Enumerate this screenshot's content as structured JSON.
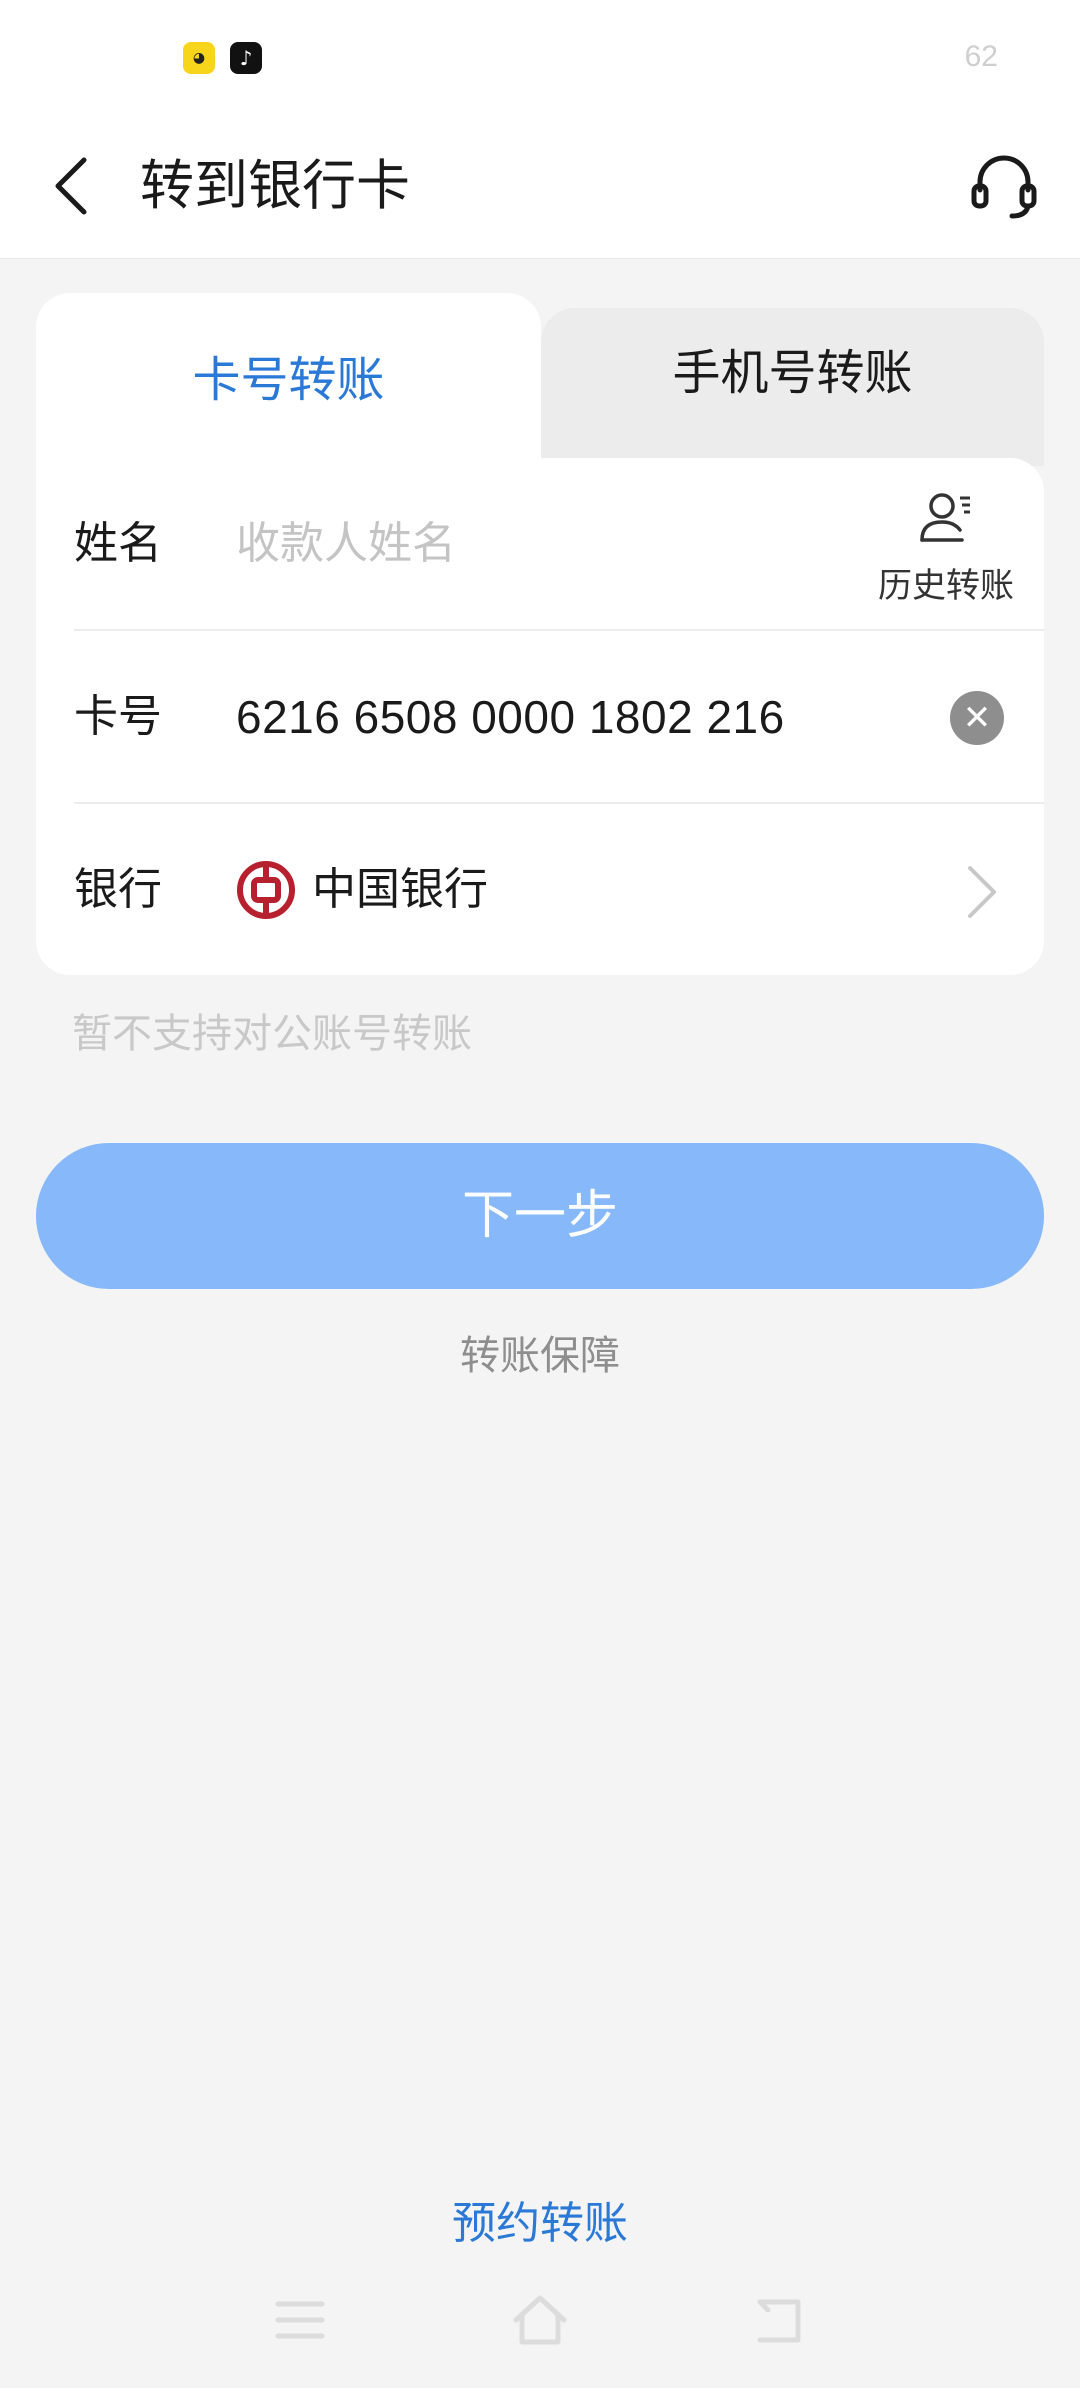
{
  "status_bar": {
    "app_icons": [
      "game-app-icon",
      "tiktok-app-icon"
    ],
    "right_text": "62"
  },
  "header": {
    "title": "转到银行卡",
    "back_icon": "chevron-left-icon",
    "support_icon": "headset-icon"
  },
  "tabs": [
    {
      "label": "卡号转账",
      "active": true
    },
    {
      "label": "手机号转账",
      "active": false
    }
  ],
  "form": {
    "name": {
      "label": "姓名",
      "placeholder": "收款人姓名",
      "value": "",
      "history_label": "历史转账"
    },
    "card": {
      "label": "卡号",
      "value": "6216 6508 0000 1802 216"
    },
    "bank": {
      "label": "银行",
      "value": "中国银行"
    }
  },
  "notice": "暂不支持对公账号转账",
  "next_button": "下一步",
  "guarantee_link": "转账保障",
  "schedule_link": "预约转账",
  "colors": {
    "accent": "#2a79d6",
    "button": "#86b8fa",
    "bank_logo": "#b7202e",
    "background": "#f4f4f4"
  }
}
